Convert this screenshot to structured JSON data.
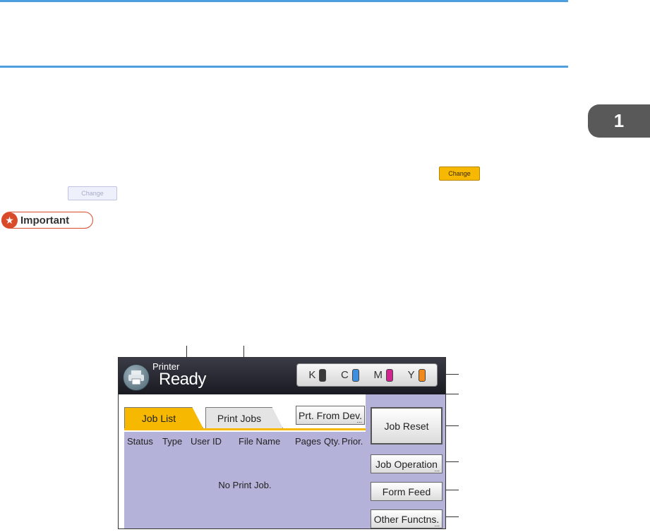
{
  "chapter": {
    "number": "1"
  },
  "inline_buttons": {
    "change_active": "Change",
    "change_disabled": "Change"
  },
  "important": {
    "label": "Important"
  },
  "panel": {
    "mode": "Printer",
    "status": "Ready",
    "toner": [
      {
        "letter": "K",
        "color": "#3a3a3a"
      },
      {
        "letter": "C",
        "color": "#3f8fe0"
      },
      {
        "letter": "M",
        "color": "#d0258f"
      },
      {
        "letter": "Y",
        "color": "#f08a1c"
      }
    ],
    "tabs": {
      "job_list": "Job List",
      "print_jobs": "Print Jobs"
    },
    "prt_from_dev": "Prt. From Dev.",
    "columns": {
      "status": "Status",
      "type": "Type",
      "user_id": "User ID",
      "file_name": "File Name",
      "pages": "Pages",
      "qty": "Qty.",
      "prior": "Prior."
    },
    "empty_message": "No Print Job.",
    "buttons": {
      "job_reset": "Job Reset",
      "job_operation": "Job Operation",
      "form_feed": "Form Feed",
      "other_functions": "Other Functns."
    },
    "dots": "..."
  }
}
